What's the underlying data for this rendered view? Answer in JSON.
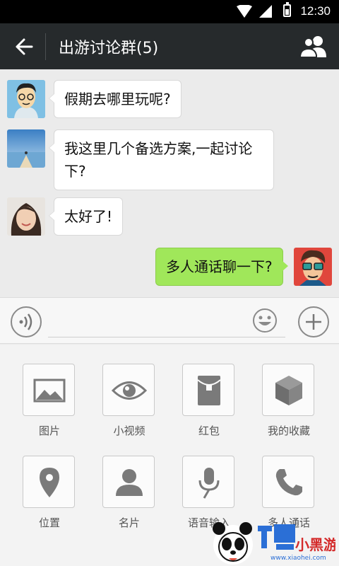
{
  "status_bar": {
    "time": "12:30"
  },
  "header": {
    "title": "出游讨论群(5)"
  },
  "messages": [
    {
      "side": "left",
      "text": "假期去哪里玩呢?"
    },
    {
      "side": "left",
      "text": "我这里几个备选方案,一起讨论下?"
    },
    {
      "side": "left",
      "text": "太好了!"
    },
    {
      "side": "right",
      "text": "多人通话聊一下?"
    }
  ],
  "tools": [
    {
      "label": "图片",
      "icon": "image-icon"
    },
    {
      "label": "小视频",
      "icon": "eye-icon"
    },
    {
      "label": "红包",
      "icon": "red-packet-icon"
    },
    {
      "label": "我的收藏",
      "icon": "cube-icon"
    },
    {
      "label": "位置",
      "icon": "location-pin-icon"
    },
    {
      "label": "名片",
      "icon": "person-icon"
    },
    {
      "label": "语音输入",
      "icon": "microphone-icon"
    },
    {
      "label": "多人通话",
      "icon": "phone-icon"
    }
  ],
  "watermark": {
    "text": "小黑游戏",
    "url": "www.xiaohei.com"
  },
  "colors": {
    "header": "#262a2c",
    "bubble_right": "#a0e75a",
    "background": "#ebebeb"
  }
}
